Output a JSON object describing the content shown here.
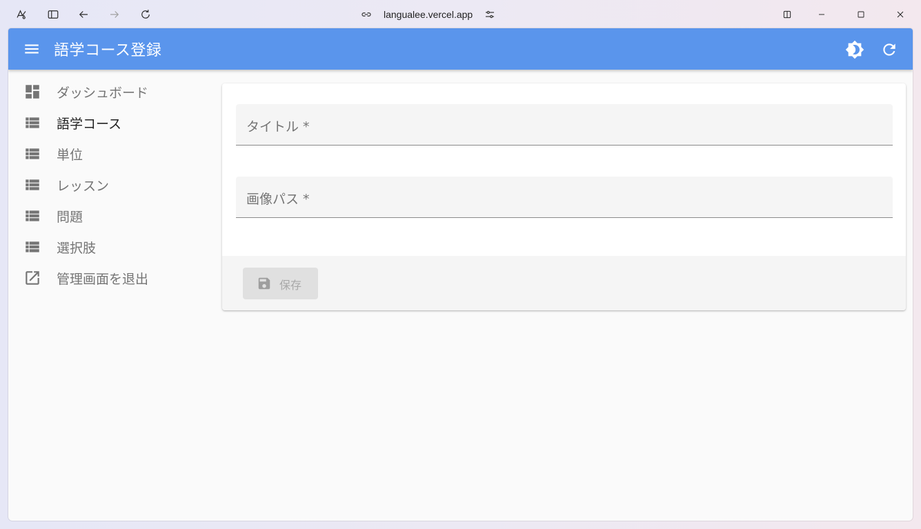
{
  "browser": {
    "url": "langualee.vercel.app",
    "icons": [
      "browser-logo-icon",
      "sidebar-toggle-icon",
      "back-icon",
      "forward-icon",
      "reload-icon",
      "link-icon",
      "site-settings-icon",
      "split-view-icon",
      "minimize-icon",
      "maximize-icon",
      "close-icon"
    ]
  },
  "appbar": {
    "title": "語学コース登録",
    "color": "#5a95ec",
    "icons": [
      "menu-icon",
      "brightness-icon",
      "refresh-icon"
    ]
  },
  "sidebar": {
    "items": [
      {
        "label": "ダッシュボード",
        "icon": "dashboard-icon"
      },
      {
        "label": "語学コース",
        "icon": "list-icon",
        "active": true
      },
      {
        "label": "単位",
        "icon": "list-icon"
      },
      {
        "label": "レッスン",
        "icon": "list-icon"
      },
      {
        "label": "問題",
        "icon": "list-icon"
      },
      {
        "label": "選択肢",
        "icon": "list-icon"
      },
      {
        "label": "管理画面を退出",
        "icon": "exit-icon"
      }
    ]
  },
  "form": {
    "fields": [
      {
        "label": "タイトル *",
        "value": ""
      },
      {
        "label": "画像パス *",
        "value": ""
      }
    ],
    "save_label": "保存",
    "save_icon": "save-icon"
  }
}
